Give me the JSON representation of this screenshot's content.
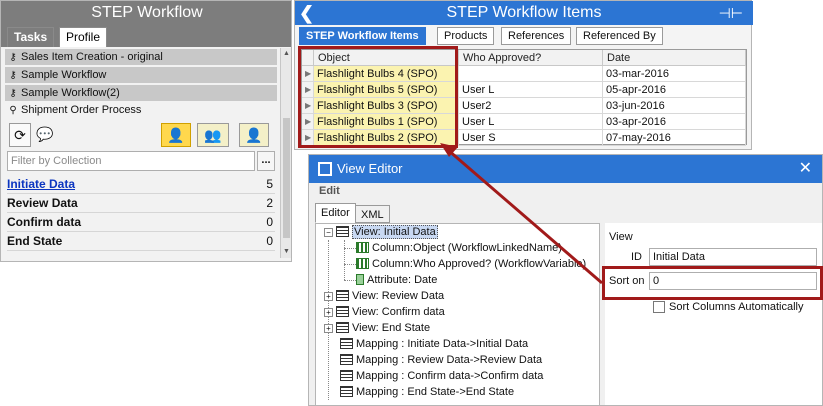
{
  "workflow_panel": {
    "title": "STEP Workflow",
    "tabs": [
      "Tasks",
      "Profile"
    ],
    "workflows": [
      {
        "label": "Sales Item Creation - original",
        "icon": "key-icon"
      },
      {
        "label": "Sample Workflow",
        "icon": "key-icon"
      },
      {
        "label": "Sample Workflow(2)",
        "icon": "key-icon"
      },
      {
        "label": "Shipment Order Process",
        "icon": "pin-icon"
      }
    ],
    "filter_placeholder": "Filter by Collection",
    "filter_button": "...",
    "states": [
      {
        "name": "Initiate Data",
        "count": "5"
      },
      {
        "name": "Review Data",
        "count": "2"
      },
      {
        "name": "Confirm data",
        "count": "0"
      },
      {
        "name": "End State",
        "count": "0"
      }
    ]
  },
  "items_panel": {
    "title": "STEP Workflow Items",
    "tabs": [
      "STEP Workflow Items",
      "Products",
      "References",
      "Referenced By"
    ],
    "columns": [
      "Object",
      "Who Approved?",
      "Date"
    ],
    "rows": [
      {
        "object": "Flashlight Bulbs 4 (SPO)",
        "who": "",
        "date": "03-mar-2016"
      },
      {
        "object": "Flashlight Bulbs 5 (SPO)",
        "who": "User L",
        "date": "05-apr-2016"
      },
      {
        "object": "Flashlight Bulbs 3 (SPO)",
        "who": "User2",
        "date": "03-jun-2016"
      },
      {
        "object": "Flashlight Bulbs 1 (SPO)",
        "who": "User L",
        "date": "03-apr-2016"
      },
      {
        "object": "Flashlight Bulbs 2 (SPO)",
        "who": "User S",
        "date": "07-may-2016"
      }
    ]
  },
  "view_editor": {
    "title": "View Editor",
    "toolbar_label": "Edit",
    "tabs": [
      "Editor",
      "XML"
    ],
    "tree": {
      "root": "View: Initial Data",
      "children": [
        "Column:Object (WorkflowLinkedName)",
        "Column:Who Approved? (WorkflowVariable)",
        "Attribute: Date"
      ],
      "siblings": [
        "View: Review Data",
        "View: Confirm data",
        "View: End State",
        "Mapping : Initiate Data->Initial Data",
        "Mapping : Review Data->Review Data",
        "Mapping : Confirm data->Confirm data",
        "Mapping : End State->End State"
      ]
    },
    "properties": {
      "section": "View",
      "id_label": "ID",
      "id_value": "Initial Data",
      "sort_label": "Sort on",
      "sort_value": "0",
      "sort_auto_label": "Sort Columns Automatically",
      "sort_auto_checked": false
    }
  },
  "colors": {
    "accent_blue": "#2c75d3",
    "annotation_red": "#a11a1a",
    "highlight_yellow": "#fbf3b0",
    "selected_user_yellow": "#ffd84d"
  }
}
